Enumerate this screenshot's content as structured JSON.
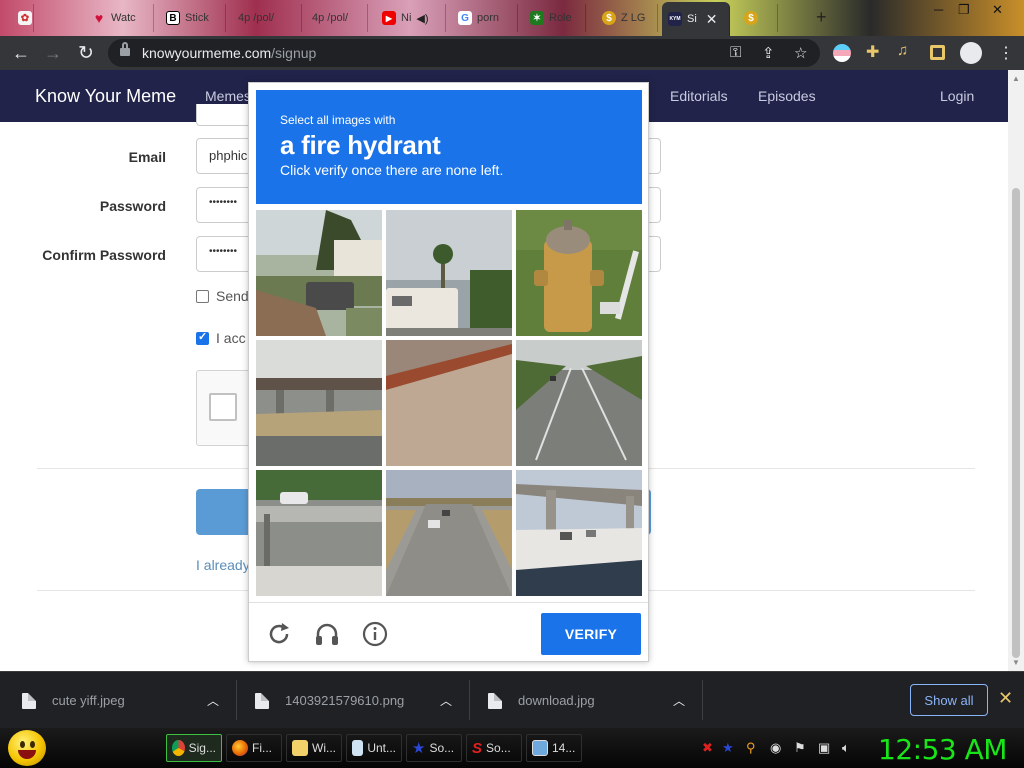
{
  "browser": {
    "tabs": [
      {
        "label": "",
        "icon": "corgi-favicon-icon"
      },
      {
        "label": "Watc",
        "icon": "heart-favicon-icon"
      },
      {
        "label": "Stick",
        "icon": "b-favicon-icon"
      },
      {
        "label": "4p /pol/",
        "icon": "4chan-favicon-icon"
      },
      {
        "label": "4p /pol/",
        "icon": "4chan-favicon-icon"
      },
      {
        "label": "Ni",
        "icon": "youtube-favicon-icon"
      },
      {
        "label": "porn",
        "icon": "google-favicon-icon"
      },
      {
        "label": "Role",
        "icon": "leaf-favicon-icon"
      },
      {
        "label": "Z LG",
        "icon": "coin-favicon-icon"
      },
      {
        "label": "Si",
        "icon": "kym-favicon-icon",
        "active": true
      },
      {
        "label": "",
        "icon": "coin-favicon-icon"
      }
    ],
    "url_host": "knowyourmeme.com",
    "url_path": "/signup"
  },
  "site": {
    "brand": "Know Your Meme",
    "nav": [
      "Memes",
      "Editorials",
      "Episodes"
    ],
    "login": "Login"
  },
  "form": {
    "email_label": "Email",
    "email_value": "phphic",
    "password_label": "Password",
    "password_value": "••••••••",
    "confirm_label": "Confirm Password",
    "confirm_value": "••••••••",
    "newsletter_label": "Send",
    "terms_label": "I acc",
    "already_text": "I already"
  },
  "captcha": {
    "prompt_small": "Select all images with",
    "prompt_big": "a fire hydrant",
    "prompt_sub": "Click verify once there are none left.",
    "verify_label": "VERIFY"
  },
  "downloads": {
    "items": [
      "cute yiff.jpeg",
      "1403921579610.png",
      "download.jpg"
    ],
    "show_all": "Show all"
  },
  "taskbar": {
    "items": [
      {
        "label": "Sig...",
        "icon": "chrome-icon",
        "active": true
      },
      {
        "label": "Fi...",
        "icon": "firefox-icon"
      },
      {
        "label": "Wi...",
        "icon": "folder-icon"
      },
      {
        "label": "Unt...",
        "icon": "notepad-icon"
      },
      {
        "label": "So...",
        "icon": "star-app-icon"
      },
      {
        "label": "So...",
        "icon": "s-app-icon"
      },
      {
        "label": "14...",
        "icon": "image-viewer-icon"
      }
    ],
    "clock": "12:53 AM"
  }
}
